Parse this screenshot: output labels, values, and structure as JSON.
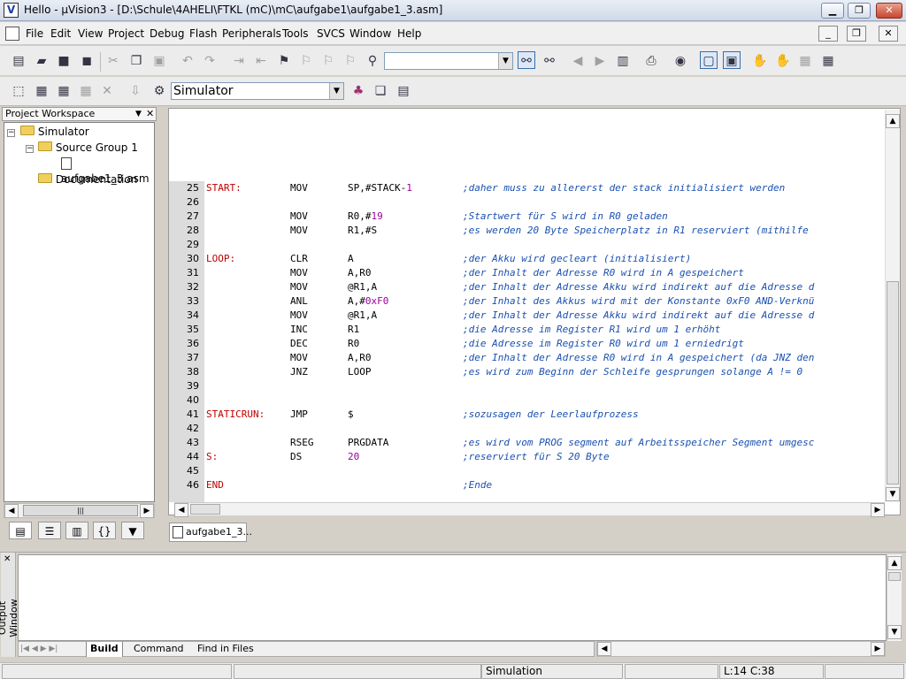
{
  "window": {
    "title": "Hello  - µVision3 - [D:\\Schule\\4AHELI\\FTKL (mC)\\mC\\aufgabe1\\aufgabe1_3.asm]"
  },
  "menu": [
    "File",
    "Edit",
    "View",
    "Project",
    "Debug",
    "Flash",
    "Peripherals",
    "Tools",
    "SVCS",
    "Window",
    "Help"
  ],
  "toolbar": {
    "target": "Simulator",
    "find_value": ""
  },
  "workspace": {
    "title": "Project Workspace",
    "tree": {
      "root": "Simulator",
      "group": "Source Group 1",
      "file": "aufgabe1_3.asm",
      "docs": "Documentation"
    }
  },
  "editor": {
    "tab": "aufgabe1_3...",
    "lines": [
      {
        "n": "25",
        "label": "START:",
        "op": "MOV",
        "args": [
          "SP,#STACK-",
          "1",
          ""
        ],
        "comment": ";daher muss zu allererst der stack initialisiert werden"
      },
      {
        "n": "26",
        "label": "",
        "op": "",
        "args": [
          "",
          "",
          ""
        ],
        "comment": ""
      },
      {
        "n": "27",
        "label": "",
        "op": "MOV",
        "args": [
          "R0,#",
          "19",
          ""
        ],
        "comment": ";Startwert für S wird in R0 geladen"
      },
      {
        "n": "28",
        "label": "",
        "op": "MOV",
        "args": [
          "R1,#S",
          "",
          ""
        ],
        "comment": ";es werden 20 Byte Speicherplatz in R1 reserviert (mithilfe"
      },
      {
        "n": "29",
        "label": "",
        "op": "",
        "args": [
          "",
          "",
          ""
        ],
        "comment": ""
      },
      {
        "n": "30",
        "label": "LOOP:",
        "op": "CLR",
        "args": [
          "A",
          "",
          ""
        ],
        "comment": ";der Akku wird gecleart (initialisiert)"
      },
      {
        "n": "31",
        "label": "",
        "op": "MOV",
        "args": [
          "A,R0",
          "",
          ""
        ],
        "comment": ";der Inhalt der Adresse R0 wird in A gespeichert"
      },
      {
        "n": "32",
        "label": "",
        "op": "MOV",
        "args": [
          "@R1,A",
          "",
          ""
        ],
        "comment": ";der Inhalt der Adresse Akku wird indirekt auf die Adresse d"
      },
      {
        "n": "33",
        "label": "",
        "op": "ANL",
        "args": [
          "A,#",
          "0xF0",
          ""
        ],
        "comment": ";der Inhalt des Akkus wird mit der Konstante 0xF0 AND-Verknü"
      },
      {
        "n": "34",
        "label": "",
        "op": "MOV",
        "args": [
          "@R1,A",
          "",
          ""
        ],
        "comment": ";der Inhalt der Adresse Akku wird indirekt auf die Adresse d"
      },
      {
        "n": "35",
        "label": "",
        "op": "INC",
        "args": [
          "R1",
          "",
          ""
        ],
        "comment": ";die Adresse im Register R1 wird um 1 erhöht"
      },
      {
        "n": "36",
        "label": "",
        "op": "DEC",
        "args": [
          "R0",
          "",
          ""
        ],
        "comment": ";die Adresse im Register R0 wird um 1 erniedrigt"
      },
      {
        "n": "37",
        "label": "",
        "op": "MOV",
        "args": [
          "A,R0",
          "",
          ""
        ],
        "comment": ";der Inhalt der Adresse R0 wird in A gespeichert (da JNZ den"
      },
      {
        "n": "38",
        "label": "",
        "op": "JNZ",
        "args": [
          "LOOP",
          "",
          ""
        ],
        "comment": ";es wird zum Beginn der Schleife gesprungen solange A != 0"
      },
      {
        "n": "39",
        "label": "",
        "op": "",
        "args": [
          "",
          "",
          ""
        ],
        "comment": ""
      },
      {
        "n": "40",
        "label": "",
        "op": "",
        "args": [
          "",
          "",
          ""
        ],
        "comment": ""
      },
      {
        "n": "41",
        "label": "STATICRUN:",
        "op": "JMP",
        "args": [
          "$",
          "",
          ""
        ],
        "comment": ";sozusagen der Leerlaufprozess"
      },
      {
        "n": "42",
        "label": "",
        "op": "",
        "args": [
          "",
          "",
          ""
        ],
        "comment": ""
      },
      {
        "n": "43",
        "label": "",
        "op": "RSEG",
        "args": [
          "PRGDATA",
          "",
          ""
        ],
        "comment": ";es wird vom PROG segment auf Arbeitsspeicher Segment umgesc"
      },
      {
        "n": "44",
        "label": "S:",
        "op": "DS",
        "args": [
          "",
          "20",
          ""
        ],
        "comment": ";reserviert für S 20 Byte"
      },
      {
        "n": "45",
        "label": "",
        "op": "",
        "args": [
          "",
          "",
          ""
        ],
        "comment": ""
      },
      {
        "n": "46",
        "label": "END",
        "op": "",
        "args": [
          "",
          "",
          ""
        ],
        "comment": ";Ende"
      }
    ]
  },
  "output": {
    "title": "Output Window",
    "tabs": [
      "Build",
      "Command",
      "Find in Files"
    ]
  },
  "status": {
    "mode": "Simulation",
    "position": "L:14 C:38"
  }
}
